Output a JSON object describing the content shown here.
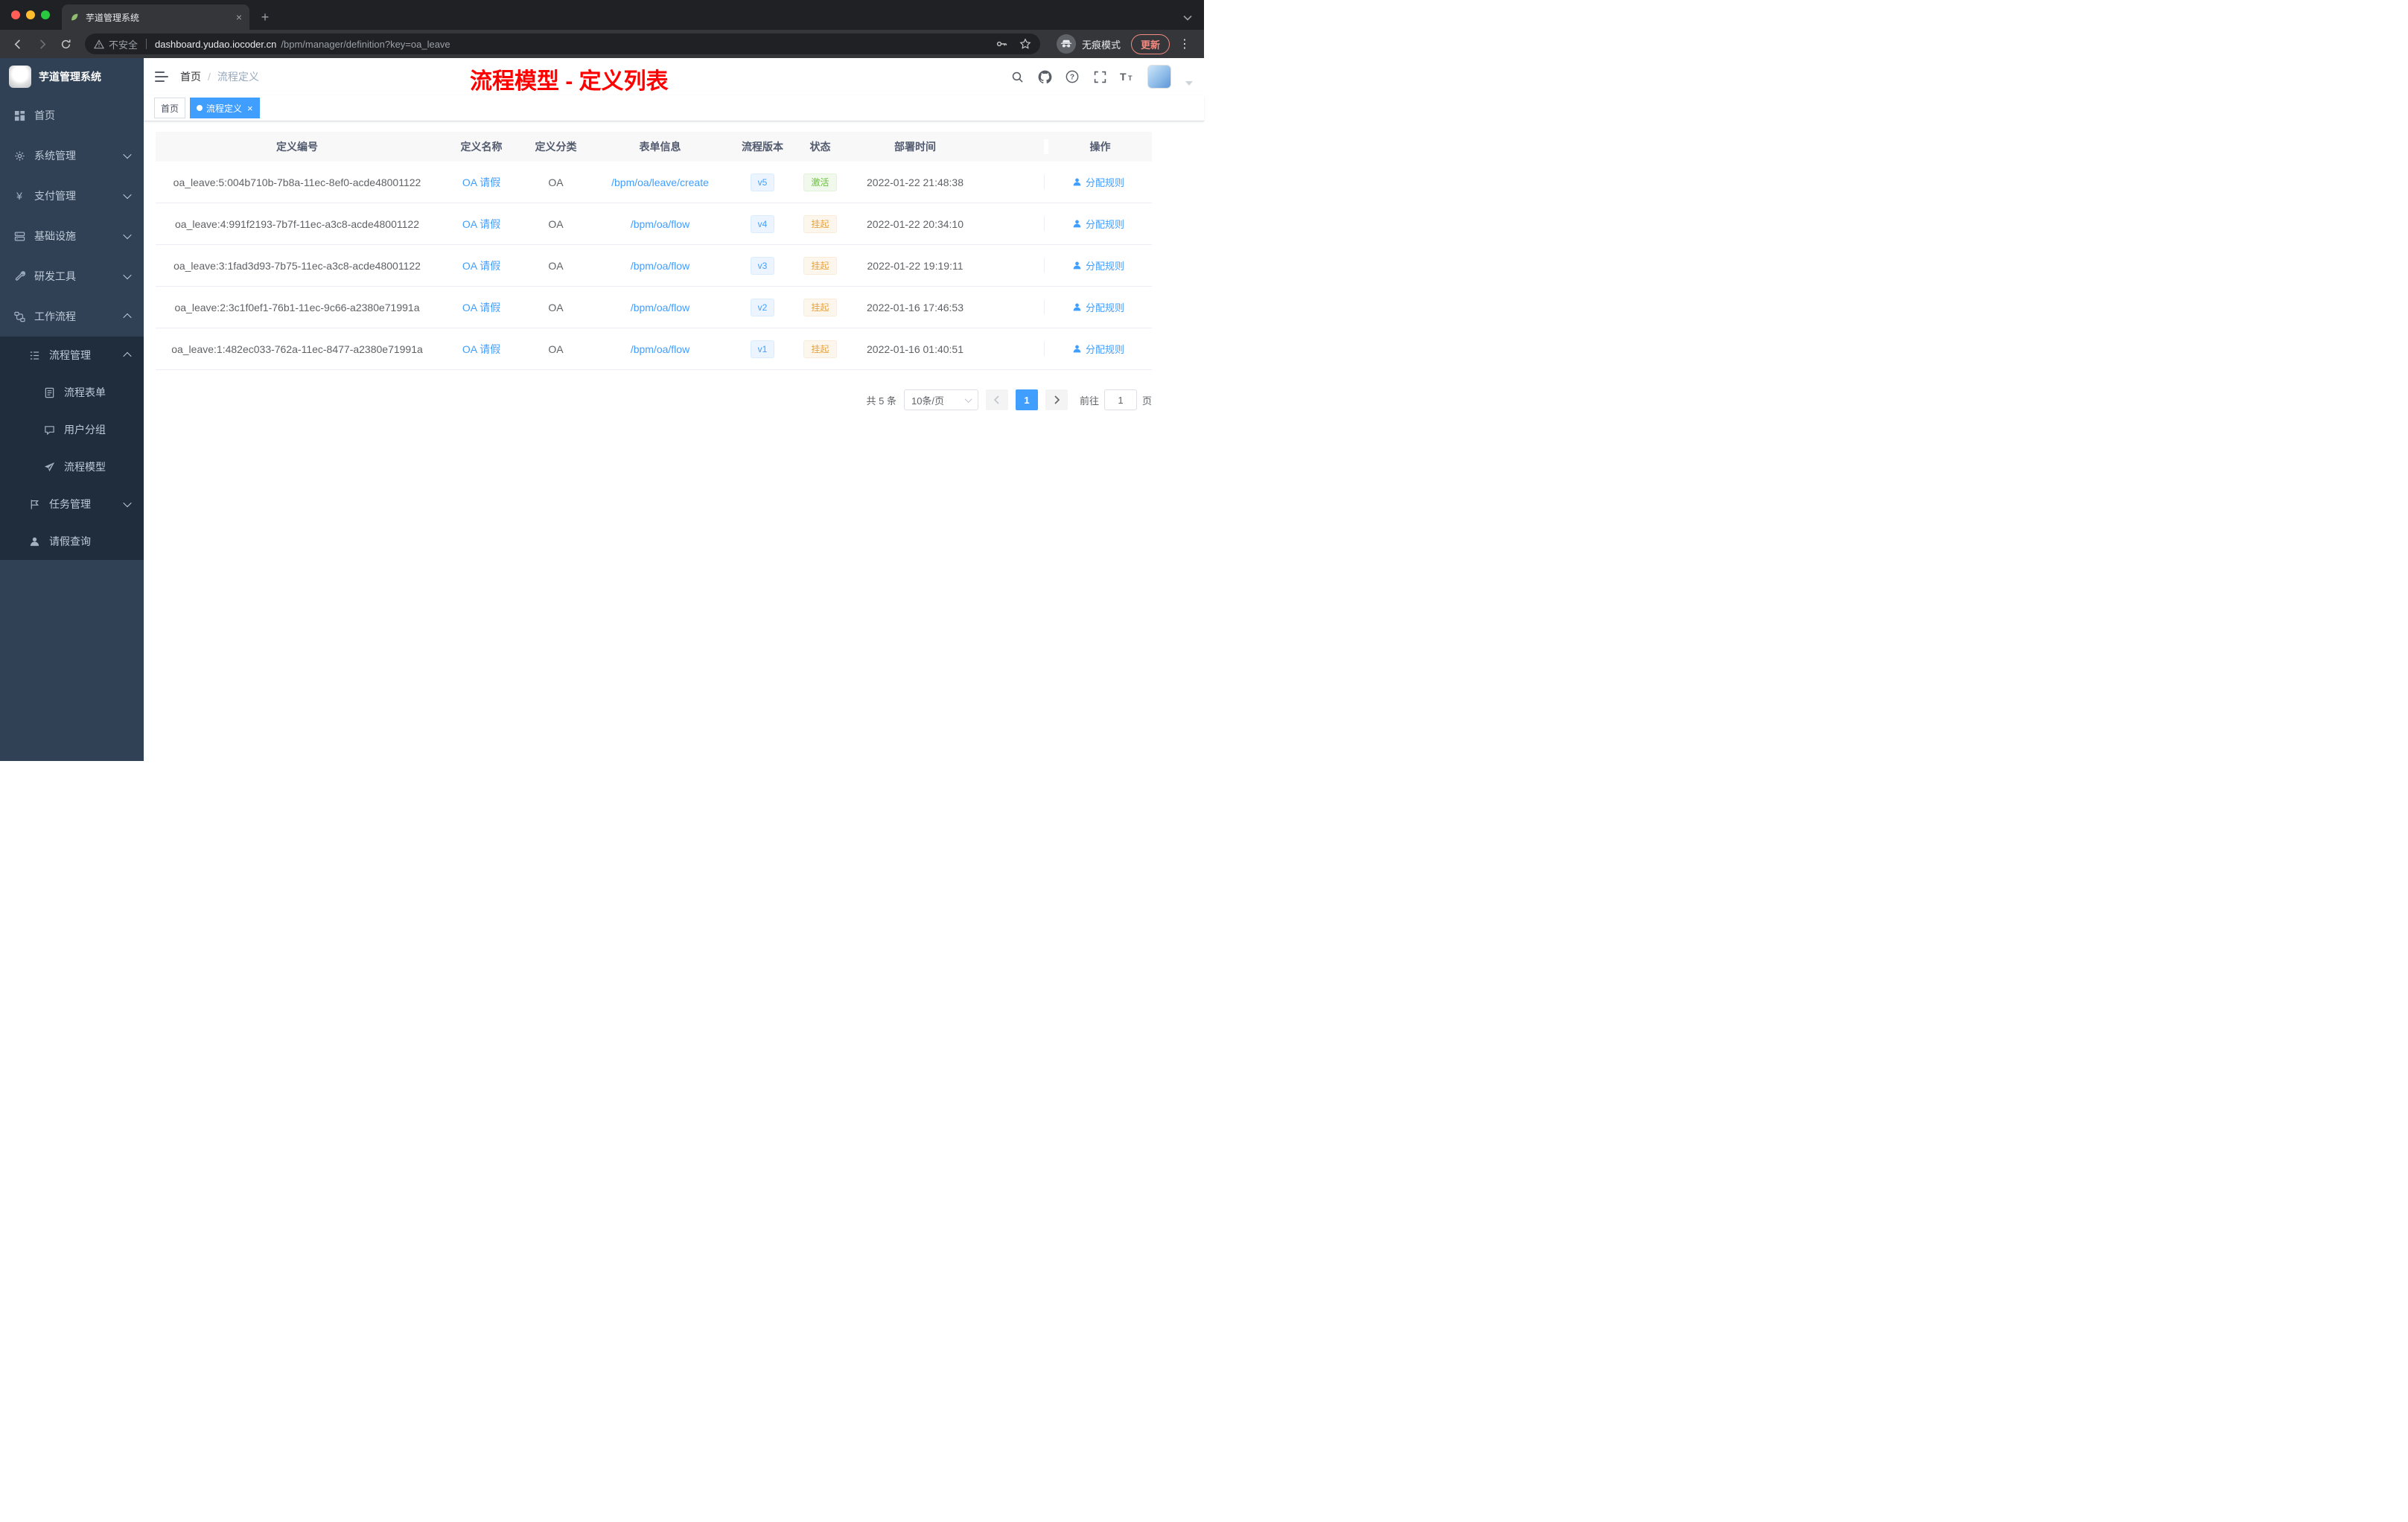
{
  "browser": {
    "tab_title": "芋道管理系统",
    "security_label": "不安全",
    "url_host": "dashboard.yudao.iocoder.cn",
    "url_path": "/bpm/manager/definition?key=oa_leave",
    "incognito_label": "无痕模式",
    "update_label": "更新"
  },
  "sidebar": {
    "logo_title": "芋道管理系统",
    "menu": [
      {
        "label": "首页"
      },
      {
        "label": "系统管理"
      },
      {
        "label": "支付管理"
      },
      {
        "label": "基础设施"
      },
      {
        "label": "研发工具"
      },
      {
        "label": "工作流程"
      }
    ],
    "process_group": {
      "label": "流程管理",
      "children": [
        {
          "label": "流程表单"
        },
        {
          "label": "用户分组"
        },
        {
          "label": "流程模型"
        }
      ]
    },
    "rest": [
      {
        "label": "任务管理"
      },
      {
        "label": "请假查询"
      }
    ]
  },
  "header": {
    "breadcrumb_home": "首页",
    "breadcrumb_current": "流程定义",
    "overlay_title": "流程模型 - 定义列表"
  },
  "tags_view": {
    "home": "首页",
    "active": "流程定义"
  },
  "table": {
    "columns": [
      "定义编号",
      "定义名称",
      "定义分类",
      "表单信息",
      "流程版本",
      "状态",
      "部署时间",
      "操作"
    ],
    "action_label": "分配规则",
    "rows": [
      {
        "id": "oa_leave:5:004b710b-7b8a-11ec-8ef0-acde48001122",
        "name": "OA 请假",
        "category": "OA",
        "form": "/bpm/oa/leave/create",
        "version": "v5",
        "status": "激活",
        "status_type": "success",
        "time": "2022-01-22 21:48:38"
      },
      {
        "id": "oa_leave:4:991f2193-7b7f-11ec-a3c8-acde48001122",
        "name": "OA 请假",
        "category": "OA",
        "form": "/bpm/oa/flow",
        "version": "v4",
        "status": "挂起",
        "status_type": "warning",
        "time": "2022-01-22 20:34:10"
      },
      {
        "id": "oa_leave:3:1fad3d93-7b75-11ec-a3c8-acde48001122",
        "name": "OA 请假",
        "category": "OA",
        "form": "/bpm/oa/flow",
        "version": "v3",
        "status": "挂起",
        "status_type": "warning",
        "time": "2022-01-22 19:19:11"
      },
      {
        "id": "oa_leave:2:3c1f0ef1-76b1-11ec-9c66-a2380e71991a",
        "name": "OA 请假",
        "category": "OA",
        "form": "/bpm/oa/flow",
        "version": "v2",
        "status": "挂起",
        "status_type": "warning",
        "time": "2022-01-16 17:46:53"
      },
      {
        "id": "oa_leave:1:482ec033-762a-11ec-8477-a2380e71991a",
        "name": "OA 请假",
        "category": "OA",
        "form": "/bpm/oa/flow",
        "version": "v1",
        "status": "挂起",
        "status_type": "warning",
        "time": "2022-01-16 01:40:51"
      }
    ]
  },
  "pagination": {
    "total": "共 5 条",
    "page_size": "10条/页",
    "current_page": "1",
    "goto_label": "前往",
    "goto_value": "1",
    "page_unit": "页"
  },
  "colors": {
    "accent": "#409eff",
    "success": "#67c23a",
    "warning": "#e6a23c",
    "title_red": "#ff0000",
    "sidebar_bg": "#304156",
    "submenu_bg": "#1f2d3d"
  }
}
